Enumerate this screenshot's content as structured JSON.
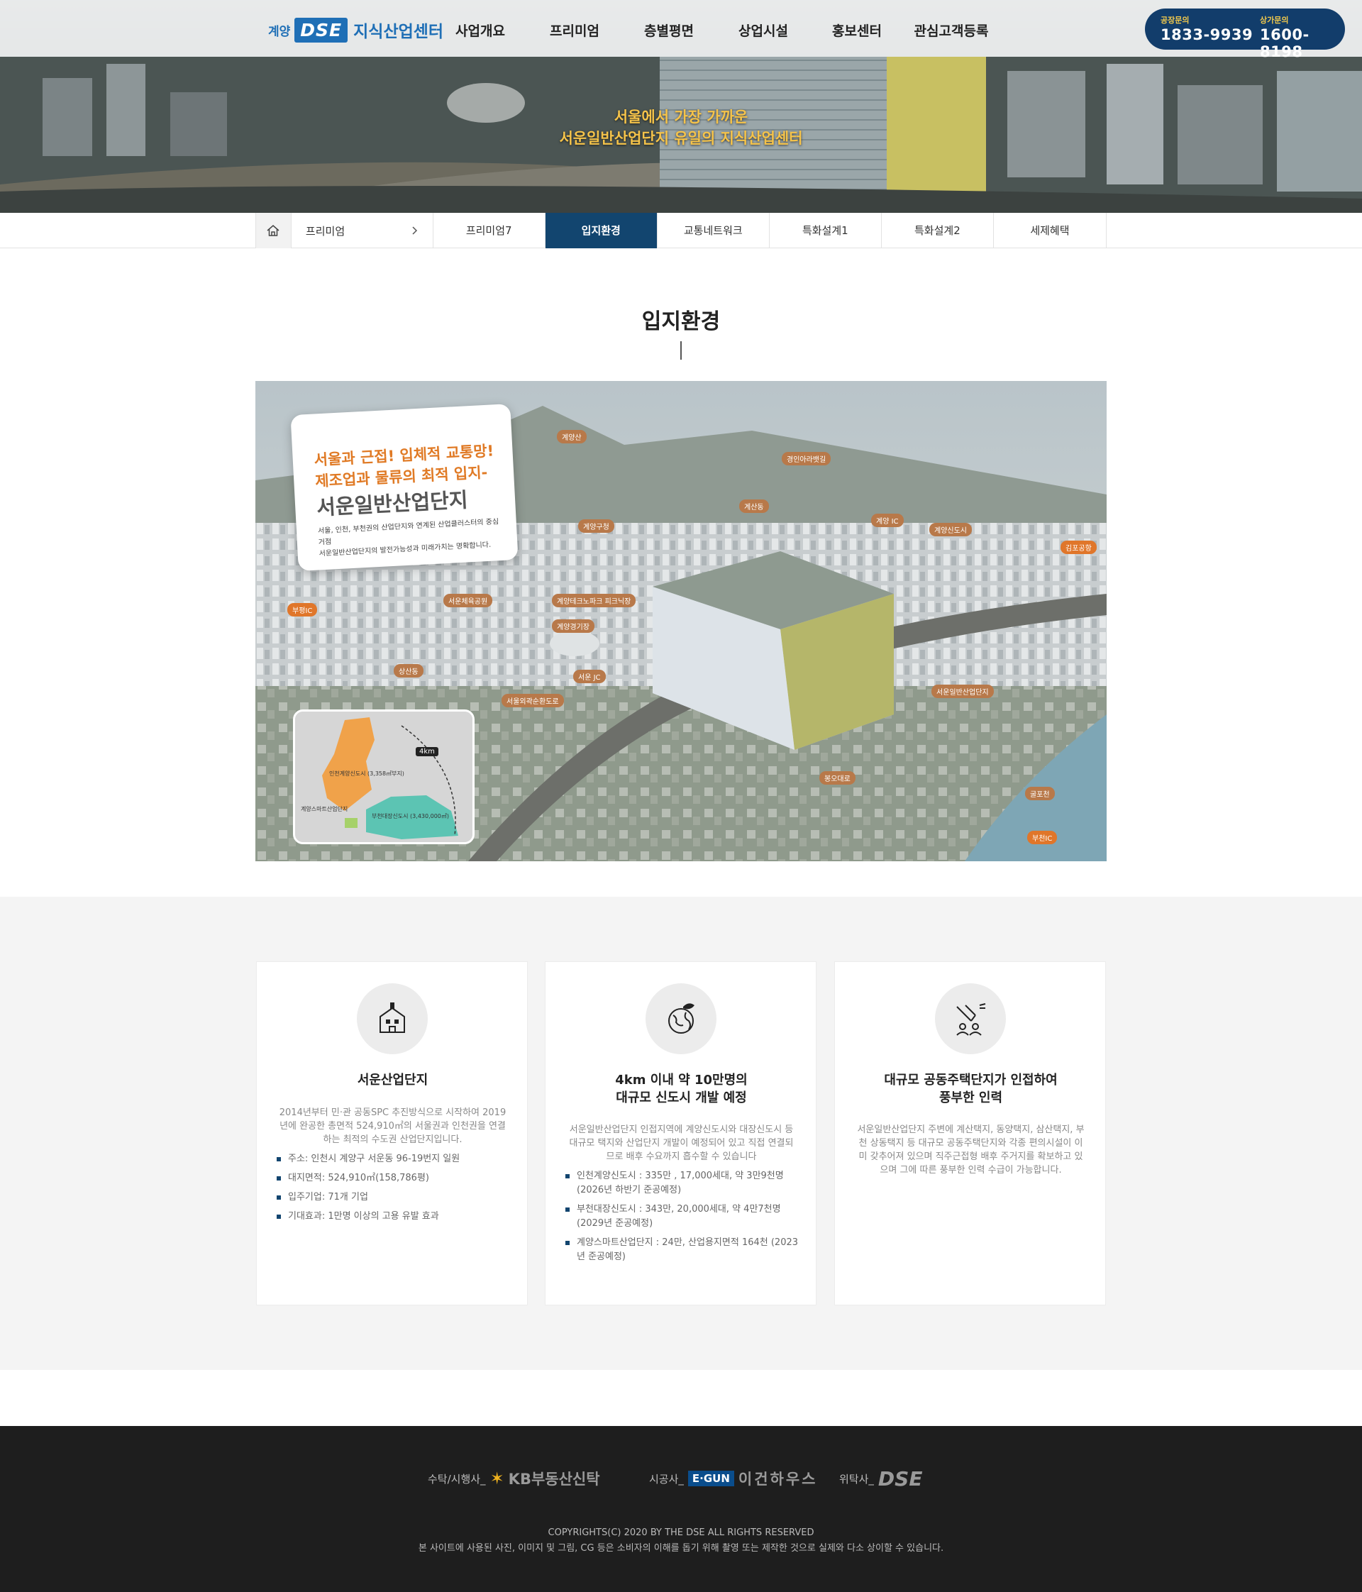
{
  "header": {
    "logo_prefix": "계양",
    "logo_mark": "DSE",
    "logo_name": "지식산업센터",
    "nav": [
      "사업개요",
      "프리미엄",
      "층별평면",
      "상업시설",
      "홍보센터",
      "관심고객등록"
    ],
    "contact": {
      "label1": "공장문의",
      "phone1": "1833-9939",
      "label2": "상가문의",
      "phone2": "1600-8198"
    }
  },
  "hero": {
    "line1": "서울에서 가장 가까운",
    "line2": "서운일반산업단지 유일의 지식산업센터"
  },
  "subnav": {
    "home_icon": "home-icon",
    "crumb": "프리미엄",
    "tabs": [
      "프리미엄7",
      "입지환경",
      "교통네트워크",
      "특화설계1",
      "특화설계2",
      "세제혜택"
    ],
    "active_tab": 1
  },
  "section": {
    "title": "입지환경"
  },
  "map": {
    "card_h1a": "서울과 근접! 입체적 교통망!",
    "card_h1b": "제조업과 물류의 최적 입지-",
    "card_h2": "서운일반산업단지",
    "card_p1": "서울, 인천, 부천권의 산업단지와 연계된 산업클러스터의 중심거점",
    "card_p2": "서운일반산업단지의 발전가능성과 미래가치는 명확합니다.",
    "tags": [
      "계양산",
      "경인아라뱃길",
      "계산동",
      "계양구청",
      "계양 IC",
      "계양신도시",
      "김포공항",
      "부평IC",
      "서운체육공원",
      "계양테크노파크 피크닉장",
      "계양경기장",
      "서운 JC",
      "상산동",
      "서울외곽순환도로",
      "서운일반산업단지",
      "봉오대로",
      "굴포천",
      "부천IC"
    ],
    "minimap": {
      "km": "4km",
      "label1": "인천계양신도시 (3,358㎡부지)",
      "label2": "계양스마트산업단지",
      "label3": "부천대장신도시 (3,430,000㎡)"
    }
  },
  "features": [
    {
      "icon": "industrial-complex-icon",
      "title": "서운산업단지",
      "desc": "2014년부터 민·관 공동SPC 추진방식으로 시작하여 2019년에 완공한 총면적 524,910㎡의 서울권과 인천권을 연결하는 최적의 수도권 산업단지입니다.",
      "items": [
        "주소: 인천시 계양구 서운동 96-19번지 일원",
        "대지면적: 524,910㎡(158,786평)",
        "입주기업: 71개 기업",
        "기대효과: 1만명 이상의 고용 유발 효과"
      ]
    },
    {
      "icon": "globe-icon",
      "title": "4km 이내 약 10만명의\n대규모 신도시 개발 예정",
      "desc": "서운일반산업단지 인접지역에 계양신도시와 대장신도시 등 대규모 택지와 산업단지 개발이 예정되어 있고 직접 연결되므로 배후 수요까지 흡수할 수 있습니다",
      "items": [
        "인천계양신도시 : 335만 , 17,000세대, 약 3만9천명 (2026년 하반기 준공예정)",
        "부천대장신도시 : 343만, 20,000세대, 약 4만7천명 (2029년 준공예정)",
        "계양스마트산업단지 : 24만, 산업용지면적 164천 (2023년 준공예정)"
      ]
    },
    {
      "icon": "workforce-icon",
      "title": "대규모 공동주택단지가 인접하여\n풍부한 인력",
      "desc": "서운일반산업단지 주변에 계산택지, 동양택지, 삼산택지, 부천 상동택지 등 대규모 공동주택단지와 각종 편의시설이 이미 갖추어져 있으며 직주근접형 배후 주거지를 확보하고 있으며 그에 따른 풍부한 인력 수급이 가능합니다.",
      "items": []
    }
  ],
  "footer": {
    "p1_label": "수탁/시행사_",
    "p1_name": "KB부동산신탁",
    "p2_label": "시공사_",
    "p2_mark": "E·GUN",
    "p2_name": "이건하우스",
    "p3_label": "위탁사_",
    "p3_name": "DSE",
    "copyright": "COPYRIGHTS(C) 2020 BY THE DSE ALL RIGHTS RESERVED",
    "notice": "본 사이트에 사용된 사진, 이미지 및 그림, CG 등은 소비자의 이해를 돕기 위해 촬영 또는 제작한 것으로 실제와 다소 상이할 수 있습니다."
  },
  "colors": {
    "brand_blue": "#1f6fb6",
    "navy": "#12456f",
    "accent_orange": "#e07a25",
    "hero_gold": "#f5c34a"
  }
}
